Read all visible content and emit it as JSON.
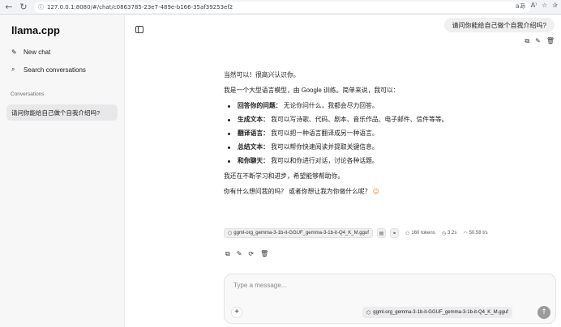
{
  "browser": {
    "url": "127.0.0.1:8080/#/chat/c0863785-23e7-489e-b166-35af39253ef2",
    "back_icon": "arrow-left",
    "forward_icon": "arrow-right",
    "reload_icon": "reload",
    "info_icon": "info",
    "right_icons": [
      "translate-icon",
      "read-aloud-icon",
      "favorite-icon",
      "extensions-icon"
    ],
    "right_glyphs": [
      "a͏あ",
      "A⁾",
      "☆",
      "✰"
    ]
  },
  "sidebar": {
    "brand": "llama.cpp",
    "new_chat": "New chat",
    "search": "Search conversations",
    "conversations_heading": "Conversations",
    "conversations": [
      {
        "title": "请问你能给自己做个自我介绍吗?"
      }
    ]
  },
  "chat": {
    "user_message": "请问你能给自己做个自我介绍吗?",
    "assistant": {
      "p1": "当然可以！很高兴认识你。",
      "p2": "我是一个大型语言模型，由 Google 训练。简单来说，我可以：",
      "items": [
        {
          "bold": "回答你的问题：",
          "text": "无论你问什么，我都会尽力回答。"
        },
        {
          "bold": "生成文本：",
          "text": "我可以写诗歌、代码、剧本、音乐作品、电子邮件、信件等等。"
        },
        {
          "bold": "翻译语言：",
          "text": "我可以把一种语言翻译成另一种语言。"
        },
        {
          "bold": "总结文本：",
          "text": "我可以帮你快速阅读并提取关键信息。"
        },
        {
          "bold": "和你聊天：",
          "text": "我可以和你进行对话，讨论各种话题。"
        }
      ],
      "p3": "我还在不断学习和进步，希望能够帮助你。",
      "p4": "你有什么想问我的吗？ 或者你想让我为你做什么呢？",
      "p4_emoji": "☺"
    },
    "meta": {
      "model": "ggml-org_gemma-3-1b-it-GGUF_gemma-3-1b-it-Q4_K_M.gguf",
      "tokens": "160 tokens",
      "time": "3.2s",
      "speed": "50.58 t/s"
    }
  },
  "composer": {
    "placeholder": "Type a message...",
    "model": "ggml-org_gemma-3-1b-it-GGUF_gemma-3-1b-it-Q4_K_M.gguf",
    "attach_label": "+",
    "send_glyph": "↑"
  }
}
